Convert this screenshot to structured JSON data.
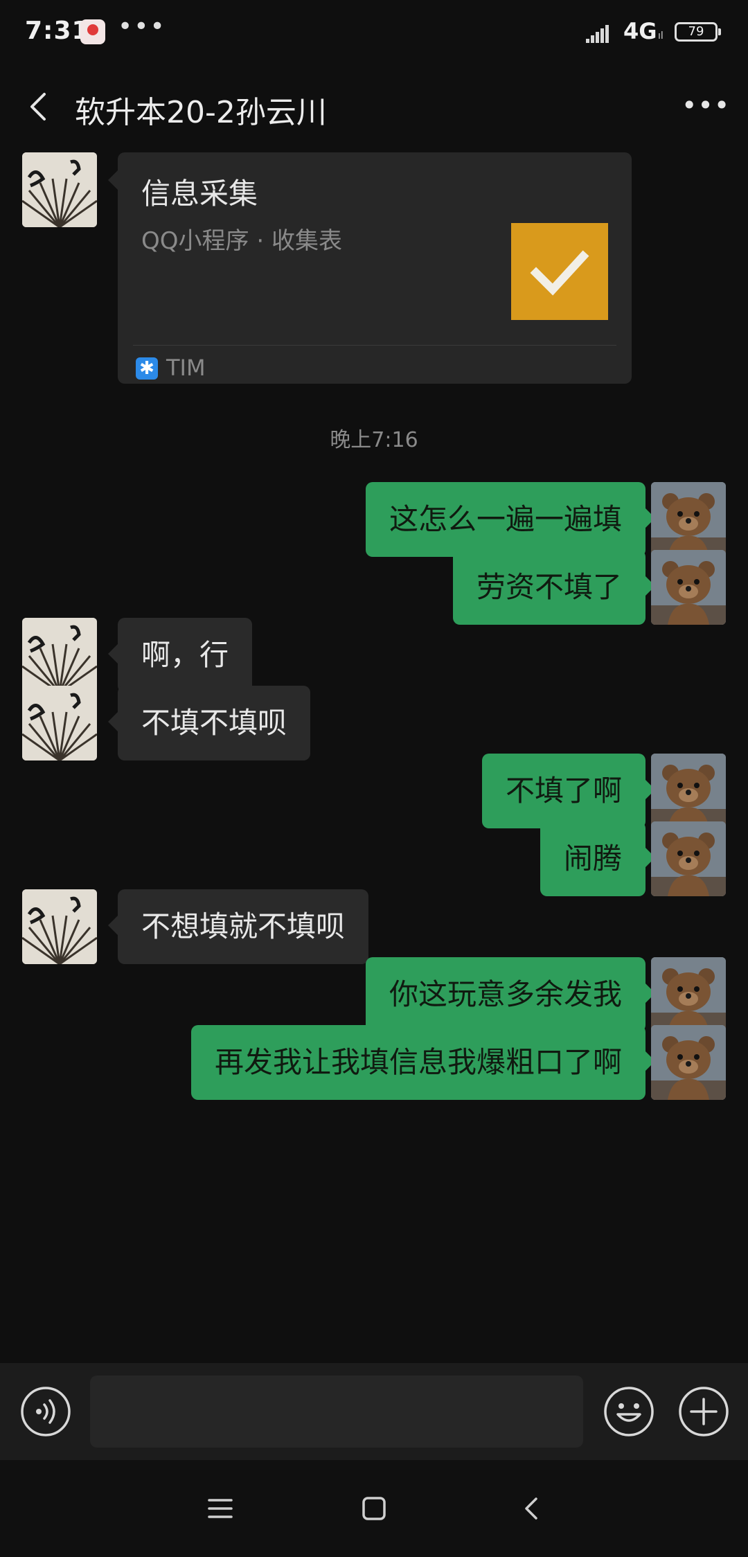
{
  "status_bar": {
    "time": "7:31",
    "more": "•••",
    "network": "4G",
    "network_sub": "ıl",
    "battery": "79"
  },
  "header": {
    "title": "软升本20-2孙云川",
    "more": "•••"
  },
  "card": {
    "title": "信息采集",
    "subtitle": "QQ小程序 · 收集表",
    "source_icon": "✱",
    "source": "TIM",
    "thumb_color": "#d99a1c"
  },
  "timestamp": "晚上7:16",
  "messages": [
    {
      "side": "right",
      "text": "这怎么一遍一遍填"
    },
    {
      "side": "right",
      "text": "劳资不填了"
    },
    {
      "side": "left",
      "text": "啊，行"
    },
    {
      "side": "left",
      "text": "不填不填呗"
    },
    {
      "side": "right",
      "text": "不填了啊"
    },
    {
      "side": "right",
      "text": "闹腾"
    },
    {
      "side": "left",
      "text": "不想填就不填呗"
    },
    {
      "side": "right",
      "text": "你这玩意多余发我"
    },
    {
      "side": "right",
      "text": "再发我让我填信息我爆粗口了啊"
    }
  ],
  "input": {
    "placeholder": ""
  },
  "colors": {
    "outgoing_bubble": "#2e9e5b",
    "incoming_bubble": "#2a2a2a",
    "background": "#0f0f0f"
  }
}
